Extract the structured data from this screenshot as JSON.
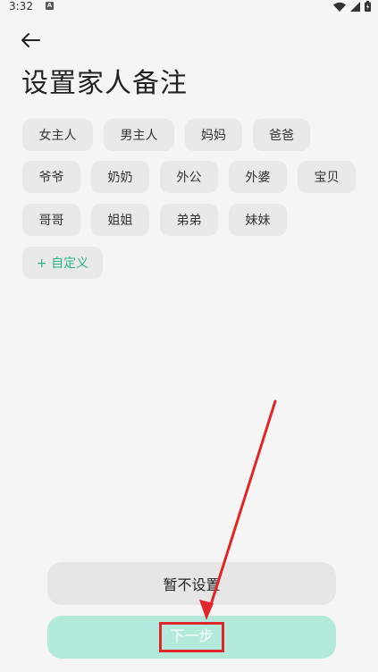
{
  "status_bar": {
    "time": "3:32",
    "badge": "A"
  },
  "header": {
    "title": "设置家人备注"
  },
  "chips": [
    {
      "label": "女主人"
    },
    {
      "label": "男主人"
    },
    {
      "label": "妈妈"
    },
    {
      "label": "爸爸"
    },
    {
      "label": "爷爷"
    },
    {
      "label": "奶奶"
    },
    {
      "label": "外公"
    },
    {
      "label": "外婆"
    },
    {
      "label": "宝贝"
    },
    {
      "label": "哥哥"
    },
    {
      "label": "姐姐"
    },
    {
      "label": "弟弟"
    },
    {
      "label": "妹妹"
    }
  ],
  "custom_chip": {
    "label": "+ 自定义"
  },
  "actions": {
    "skip_label": "暂不设置",
    "next_label": "下一步"
  },
  "colors": {
    "accent": "#2bb585",
    "next_button": "#b3eadb",
    "chip_bg": "#e9e9e9",
    "annotation": "#e0262a"
  }
}
